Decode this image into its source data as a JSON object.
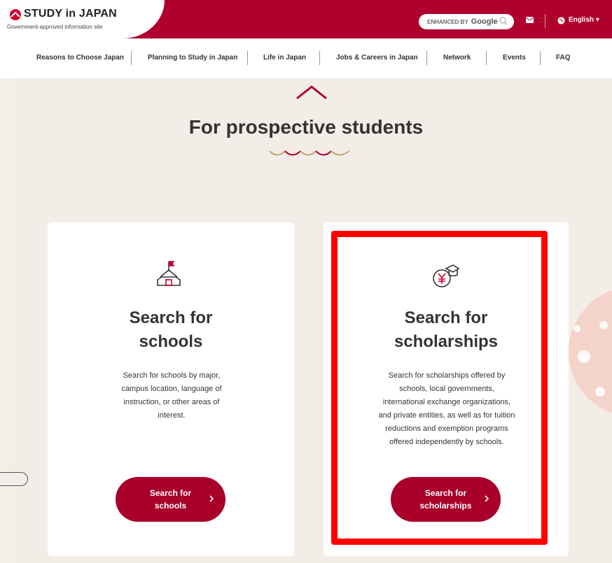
{
  "header": {
    "logo_text": "STUDY in JAPAN",
    "logo_sub": "Government-approved information site",
    "search_label": "ENHANCED BY",
    "search_brand": "Google",
    "language": "English"
  },
  "nav": {
    "items": [
      {
        "label": "Reasons to Choose Japan"
      },
      {
        "label": "Planning to Study in Japan"
      },
      {
        "label": "Life in Japan"
      },
      {
        "label": "Jobs & Careers in Japan"
      },
      {
        "label": "Network"
      },
      {
        "label": "Events"
      },
      {
        "label": "FAQ"
      }
    ]
  },
  "main": {
    "section_title": "For prospective students",
    "cards": [
      {
        "title": "Search for schools",
        "description": "Search for schools by major, campus location, language of instruction, or other areas of interest.",
        "button": "Search for schools",
        "icon": "school-icon"
      },
      {
        "title": "Search for scholarships",
        "description": "Search for scholarships offered by schools, local governments, international exchange organizations, and private entities, as well as for tuition reductions and exemption programs offered independently by schools.",
        "button": "Search for scholarships",
        "icon": "scholarship-icon"
      }
    ]
  },
  "colors": {
    "brand": "#b0002d",
    "button": "#a8002a",
    "highlight": "#ff0000",
    "background": "#f2eee7"
  }
}
